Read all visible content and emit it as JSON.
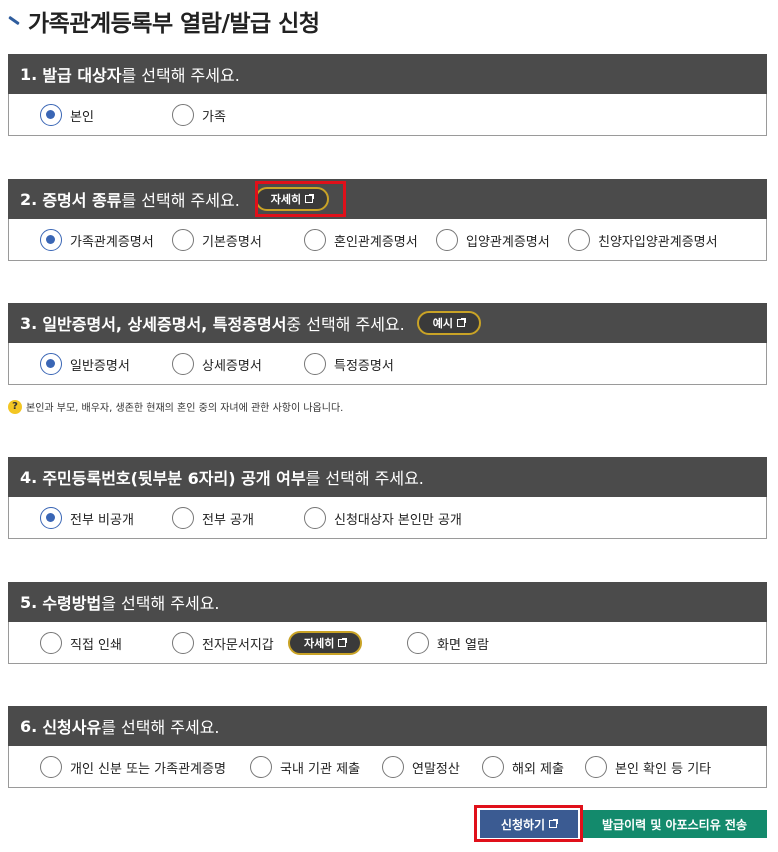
{
  "page": {
    "title": "가족관계등록부 열람/발급 신청"
  },
  "sections": [
    {
      "num": "1.",
      "head_strong": "발급 대상자",
      "head_normal": "를 선택해 주세요.",
      "options": [
        {
          "label": "본인",
          "checked": true
        },
        {
          "label": "가족",
          "checked": false
        }
      ]
    },
    {
      "num": "2.",
      "head_strong": "증명서 종류",
      "head_normal": "를 선택해 주세요.",
      "pill": "자세히",
      "options": [
        {
          "label": "가족관계증명서",
          "checked": true
        },
        {
          "label": "기본증명서",
          "checked": false
        },
        {
          "label": "혼인관계증명서",
          "checked": false
        },
        {
          "label": "입양관계증명서",
          "checked": false
        },
        {
          "label": "친양자입양관계증명서",
          "checked": false
        }
      ]
    },
    {
      "num": "3.",
      "head_strong": "일반증명서, 상세증명서, 특정증명서",
      "head_normal": " 중 선택해 주세요.",
      "pill": "예시",
      "options": [
        {
          "label": "일반증명서",
          "checked": true
        },
        {
          "label": "상세증명서",
          "checked": false
        },
        {
          "label": "특정증명서",
          "checked": false
        }
      ]
    },
    {
      "num": "4.",
      "head_strong": "주민등록번호(뒷부분 6자리) 공개 여부",
      "head_normal": "를 선택해 주세요.",
      "options": [
        {
          "label": "전부 비공개",
          "checked": true
        },
        {
          "label": "전부 공개",
          "checked": false
        },
        {
          "label": "신청대상자 본인만 공개",
          "checked": false
        }
      ]
    },
    {
      "num": "5.",
      "head_strong": "수령방법",
      "head_normal": "을 선택해 주세요.",
      "pill": "자세히",
      "options": [
        {
          "label": "직접 인쇄",
          "checked": false
        },
        {
          "label": "전자문서지갑",
          "checked": false
        },
        {
          "label": "화면 열람",
          "checked": false
        }
      ]
    },
    {
      "num": "6.",
      "head_strong": "신청사유",
      "head_normal": "를 선택해 주세요.",
      "options": [
        {
          "label": "개인 신분 또는 가족관계증명",
          "checked": false
        },
        {
          "label": "국내 기관 제출",
          "checked": false
        },
        {
          "label": "연말정산",
          "checked": false
        },
        {
          "label": "해외 제출",
          "checked": false
        },
        {
          "label": "본인 확인 등 기타",
          "checked": false
        }
      ]
    }
  ],
  "note": {
    "icon": "question-icon",
    "text": "본인과 부모, 배우자, 생존한 현재의 혼인 중의 자녀에 관한 사항이 나옵니다."
  },
  "buttons": {
    "apply": "신청하기",
    "history": "발급이력 및 아포스티유 전송"
  },
  "colors": {
    "header_bg": "#4b4b4b",
    "radio_checked": "#3a66b5",
    "pill_border": "#c9a326",
    "apply_bg": "#3b5b92",
    "history_bg": "#138a6c",
    "highlight": "#e0101a"
  }
}
